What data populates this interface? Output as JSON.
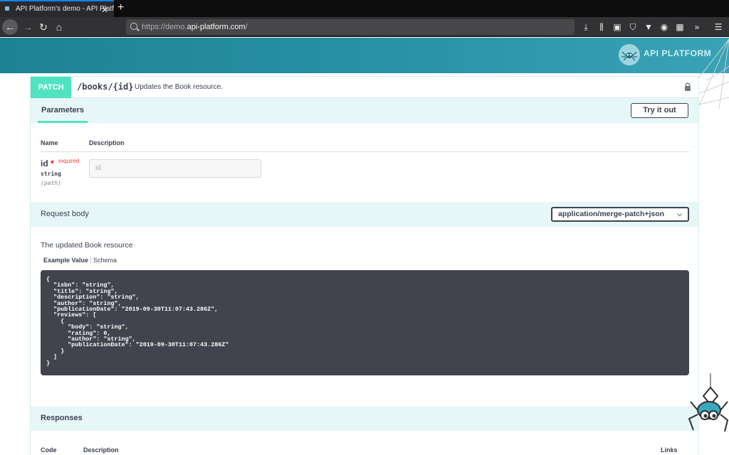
{
  "browser": {
    "tab_title": "API Platform's demo - API Platf",
    "tab_close": "✕",
    "new_tab": "+",
    "url_scheme": "https://demo.",
    "url_host": "api-platform.com",
    "url_path": "/",
    "icons": [
      "back-icon",
      "forward-icon",
      "reload-icon",
      "home-icon",
      "download-icon",
      "library-icon",
      "sidebar-icon",
      "shield-icon",
      "vpn-icon",
      "account-icon",
      "extension-icon",
      "overflow-icon",
      "menu-icon"
    ]
  },
  "site": {
    "logo_text": "API PLATFORM",
    "accent": "#2a94a8"
  },
  "operation": {
    "method": "PATCH",
    "method_color": "#50e3c2",
    "path": "/books/{id}",
    "summary": "Updates the Book resource.",
    "parameters": {
      "tab_label": "Parameters",
      "try_button": "Try it out",
      "col_name": "Name",
      "col_description": "Description",
      "items": [
        {
          "name": "id",
          "required_star": "*",
          "required_label": "required",
          "type": "string",
          "in": "(path)",
          "placeholder": "id"
        }
      ]
    },
    "request_body": {
      "title": "Request body",
      "content_type": "application/merge-patch+json",
      "description": "The updated Book resource",
      "tab_example": "Example Value",
      "tab_schema": "Schema",
      "example": "{\n  \"isbn\": \"string\",\n  \"title\": \"string\",\n  \"description\": \"string\",\n  \"author\": \"string\",\n  \"publicationDate\": \"2019-09-30T11:07:43.286Z\",\n  \"reviews\": [\n    {\n      \"body\": \"string\",\n      \"rating\": 0,\n      \"author\": \"string\",\n      \"publicationDate\": \"2019-09-30T11:07:43.286Z\"\n    }\n  ]\n}"
    },
    "responses": {
      "title": "Responses",
      "col_code": "Code",
      "col_description": "Description",
      "col_links": "Links"
    }
  }
}
